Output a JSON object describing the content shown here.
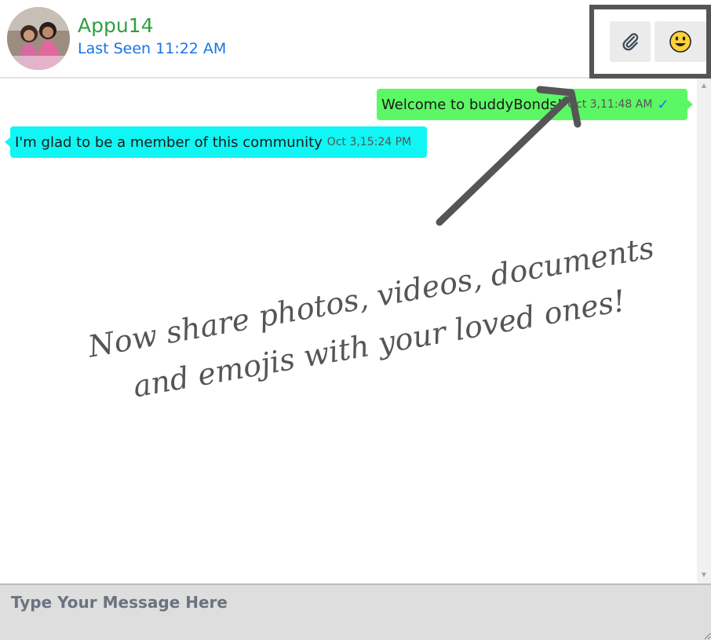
{
  "header": {
    "user_name": "Appu14",
    "last_seen": "Last Seen 11:22 AM",
    "avatar_icon": "user-photo",
    "attach_icon": "paperclip-icon",
    "emoji_icon": "smiley-emoji-icon"
  },
  "messages": [
    {
      "direction": "sent",
      "text": "Welcome to buddyBonds!",
      "time": "Oct 3,11:48 AM",
      "status": "✓"
    },
    {
      "direction": "received",
      "text": "I'm glad to be a member of this community",
      "time": "Oct 3,15:24 PM"
    }
  ],
  "annotation": {
    "line1": "Now share photos, videos, documents",
    "line2": "and emojis with your loved ones!"
  },
  "input": {
    "placeholder": "Type Your Message Here",
    "value": ""
  },
  "colors": {
    "name": "#2ea043",
    "last_seen": "#1a73e8",
    "sent_bubble": "#5cf765",
    "received_bubble": "#0ff6f4",
    "annotation": "#555555"
  }
}
